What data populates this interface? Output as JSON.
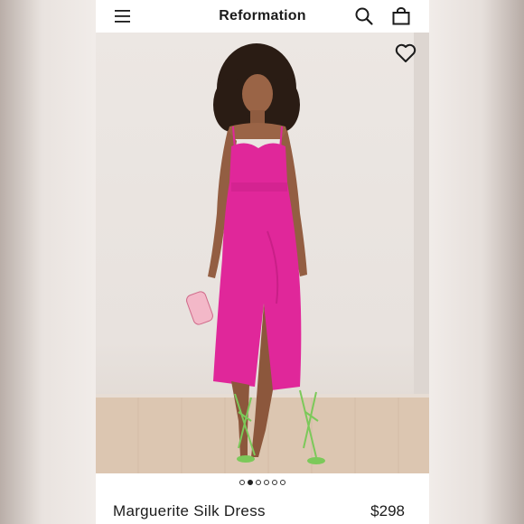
{
  "header": {
    "brand": "Reformation",
    "icons": [
      "menu-icon",
      "search-icon",
      "bag-icon"
    ]
  },
  "gallery": {
    "image_count": 6,
    "active_index": 1,
    "wishlist_icon": "heart-outline-icon"
  },
  "product": {
    "name": "Marguerite Silk Dress",
    "price": "$298"
  },
  "colors": {
    "dress": "#e0279a",
    "shoes": "#7cc95a",
    "text": "#1b1b1b"
  }
}
